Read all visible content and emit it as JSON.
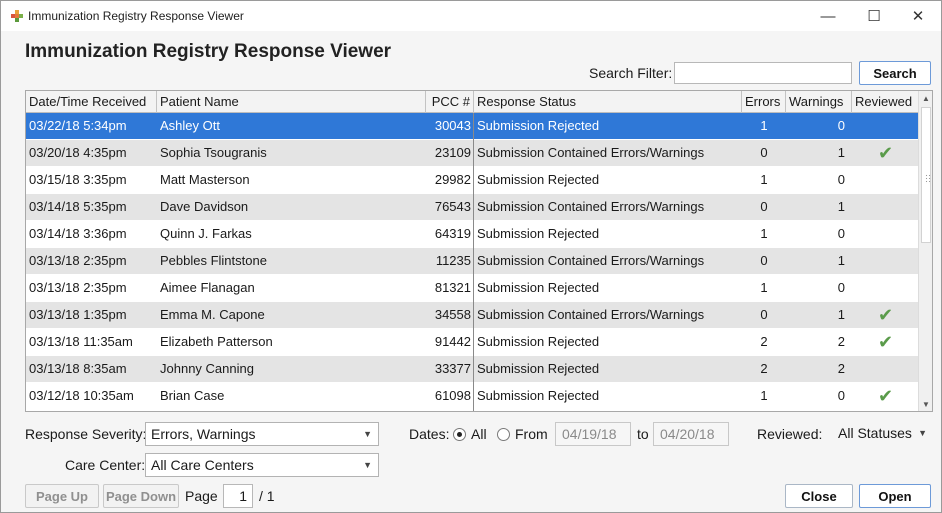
{
  "window": {
    "title": "Immunization Registry Response Viewer",
    "minimize_glyph": "—",
    "maximize_glyph": "☐",
    "close_glyph": "✕"
  },
  "heading": "Immunization Registry Response Viewer",
  "search": {
    "label": "Search Filter:",
    "value": "",
    "placeholder": "",
    "button_label": "Search"
  },
  "columns": {
    "received": "Date/Time Received",
    "patient": "Patient Name",
    "pcc": "PCC #",
    "status": "Response Status",
    "errors": "Errors",
    "warnings": "Warnings",
    "reviewed": "Reviewed"
  },
  "rows": [
    {
      "received": "03/22/18 5:34pm",
      "patient": "Ashley Ott",
      "pcc": "30043",
      "status": "Submission Rejected",
      "errors": "1",
      "warnings": "0",
      "reviewed": "",
      "selected": true
    },
    {
      "received": "03/20/18 4:35pm",
      "patient": "Sophia Tsougranis",
      "pcc": "23109",
      "status": "Submission Contained Errors/Warnings",
      "errors": "0",
      "warnings": "1",
      "reviewed": "✔"
    },
    {
      "received": "03/15/18 3:35pm",
      "patient": "Matt Masterson",
      "pcc": "29982",
      "status": "Submission Rejected",
      "errors": "1",
      "warnings": "0",
      "reviewed": ""
    },
    {
      "received": "03/14/18 5:35pm",
      "patient": "Dave Davidson",
      "pcc": "76543",
      "status": "Submission Contained Errors/Warnings",
      "errors": "0",
      "warnings": "1",
      "reviewed": ""
    },
    {
      "received": "03/14/18 3:36pm",
      "patient": "Quinn J. Farkas",
      "pcc": "64319",
      "status": "Submission Rejected",
      "errors": "1",
      "warnings": "0",
      "reviewed": ""
    },
    {
      "received": "03/13/18 2:35pm",
      "patient": "Pebbles Flintstone",
      "pcc": "11235",
      "status": "Submission Contained Errors/Warnings",
      "errors": "0",
      "warnings": "1",
      "reviewed": ""
    },
    {
      "received": "03/13/18 2:35pm",
      "patient": "Aimee Flanagan",
      "pcc": "81321",
      "status": "Submission Rejected",
      "errors": "1",
      "warnings": "0",
      "reviewed": ""
    },
    {
      "received": "03/13/18 1:35pm",
      "patient": "Emma M. Capone",
      "pcc": "34558",
      "status": "Submission Contained Errors/Warnings",
      "errors": "0",
      "warnings": "1",
      "reviewed": "✔"
    },
    {
      "received": "03/13/18 11:35am",
      "patient": "Elizabeth Patterson",
      "pcc": "91442",
      "status": "Submission Rejected",
      "errors": "2",
      "warnings": "2",
      "reviewed": "✔"
    },
    {
      "received": "03/13/18 8:35am",
      "patient": "Johnny Canning",
      "pcc": "33377",
      "status": "Submission Rejected",
      "errors": "2",
      "warnings": "2",
      "reviewed": ""
    },
    {
      "received": "03/12/18 10:35am",
      "patient": "Brian Case",
      "pcc": "61098",
      "status": "Submission Rejected",
      "errors": "1",
      "warnings": "0",
      "reviewed": "✔"
    }
  ],
  "filters": {
    "severity_label": "Response Severity:",
    "severity_value": "Errors, Warnings",
    "dates_label": "Dates:",
    "all_label": "All",
    "from_label": "From",
    "from_value": "04/19/18",
    "to_label": "to",
    "to_value": "04/20/18",
    "dates_selected": "All",
    "reviewed_label": "Reviewed:",
    "reviewed_value": "All Statuses",
    "care_center_label": "Care Center:",
    "care_center_value": "All Care Centers"
  },
  "paging": {
    "page_up_label": "Page Up",
    "page_down_label": "Page Down",
    "page_label": "Page",
    "page_value": "1",
    "page_total": "/ 1"
  },
  "actions": {
    "close_label": "Close",
    "open_label": "Open"
  },
  "colors": {
    "selection": "#2f78d7",
    "alt_row": "#e4e4e4",
    "check": "#5a9b4a"
  },
  "icons": {
    "app": "plus-cross-icon",
    "dropdown": "chevron-down-icon",
    "reviewed": "check-icon"
  }
}
